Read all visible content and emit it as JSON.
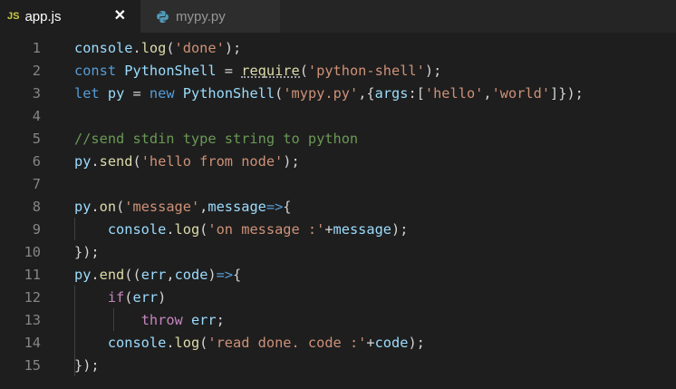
{
  "tabs": [
    {
      "icon": "JS",
      "label": "app.js",
      "close": "✕",
      "active": true
    },
    {
      "label": "mypy.py",
      "active": false
    }
  ],
  "line_numbers": [
    "1",
    "2",
    "3",
    "4",
    "5",
    "6",
    "7",
    "8",
    "9",
    "10",
    "11",
    "12",
    "13",
    "14",
    "15"
  ],
  "lines": [
    [
      [
        "id",
        "console"
      ],
      [
        "pl",
        "."
      ],
      [
        "fn",
        "log"
      ],
      [
        "pl",
        "("
      ],
      [
        "str",
        "'done'"
      ],
      [
        "pl",
        ");"
      ]
    ],
    [
      [
        "kw",
        "const"
      ],
      [
        "pl",
        " "
      ],
      [
        "id",
        "PythonShell"
      ],
      [
        "pl",
        " = "
      ],
      [
        "req",
        "require"
      ],
      [
        "pl",
        "("
      ],
      [
        "str",
        "'python-shell'"
      ],
      [
        "pl",
        ");"
      ]
    ],
    [
      [
        "kw",
        "let"
      ],
      [
        "pl",
        " "
      ],
      [
        "id",
        "py"
      ],
      [
        "pl",
        " = "
      ],
      [
        "kw",
        "new"
      ],
      [
        "pl",
        " "
      ],
      [
        "id",
        "PythonShell"
      ],
      [
        "pl",
        "("
      ],
      [
        "str",
        "'mypy.py'"
      ],
      [
        "pl",
        ",{"
      ],
      [
        "id",
        "args"
      ],
      [
        "pl",
        ":["
      ],
      [
        "str",
        "'hello'"
      ],
      [
        "pl",
        ","
      ],
      [
        "str",
        "'world'"
      ],
      [
        "pl",
        "]});"
      ]
    ],
    [],
    [
      [
        "cm",
        "//send stdin type string to python"
      ]
    ],
    [
      [
        "id",
        "py"
      ],
      [
        "pl",
        "."
      ],
      [
        "fn",
        "send"
      ],
      [
        "pl",
        "("
      ],
      [
        "str",
        "'hello from node'"
      ],
      [
        "pl",
        ");"
      ]
    ],
    [],
    [
      [
        "id",
        "py"
      ],
      [
        "pl",
        "."
      ],
      [
        "fn",
        "on"
      ],
      [
        "pl",
        "("
      ],
      [
        "str",
        "'message'"
      ],
      [
        "pl",
        ","
      ],
      [
        "id",
        "message"
      ],
      [
        "kw",
        "=>"
      ],
      [
        "pl",
        "{"
      ]
    ],
    [
      [
        "pl",
        "    "
      ],
      [
        "id",
        "console"
      ],
      [
        "pl",
        "."
      ],
      [
        "fn",
        "log"
      ],
      [
        "pl",
        "("
      ],
      [
        "str",
        "'on message :'"
      ],
      [
        "pl",
        "+"
      ],
      [
        "id",
        "message"
      ],
      [
        "pl",
        ");"
      ]
    ],
    [
      [
        "pl",
        "});"
      ]
    ],
    [
      [
        "id",
        "py"
      ],
      [
        "pl",
        "."
      ],
      [
        "fn",
        "end"
      ],
      [
        "pl",
        "(("
      ],
      [
        "id",
        "err"
      ],
      [
        "pl",
        ","
      ],
      [
        "id",
        "code"
      ],
      [
        "pl",
        ")"
      ],
      [
        "kw",
        "=>"
      ],
      [
        "pl",
        "{"
      ]
    ],
    [
      [
        "pl",
        "    "
      ],
      [
        "ctl",
        "if"
      ],
      [
        "pl",
        "("
      ],
      [
        "id",
        "err"
      ],
      [
        "pl",
        ")"
      ]
    ],
    [
      [
        "pl",
        "        "
      ],
      [
        "ctl",
        "throw"
      ],
      [
        "pl",
        " "
      ],
      [
        "id",
        "err"
      ],
      [
        "pl",
        ";"
      ]
    ],
    [
      [
        "pl",
        "    "
      ],
      [
        "id",
        "console"
      ],
      [
        "pl",
        "."
      ],
      [
        "fn",
        "log"
      ],
      [
        "pl",
        "("
      ],
      [
        "str",
        "'read done. code :'"
      ],
      [
        "pl",
        "+"
      ],
      [
        "id",
        "code"
      ],
      [
        "pl",
        ");"
      ]
    ],
    [
      [
        "pl",
        "});"
      ]
    ]
  ]
}
